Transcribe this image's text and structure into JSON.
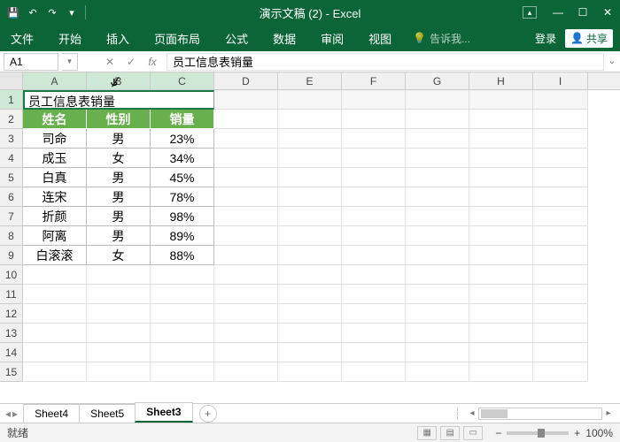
{
  "title": "演示文稿 (2) - Excel",
  "qat": {
    "save": "💾",
    "undo": "↶",
    "redo": "↷"
  },
  "ribbon": {
    "tabs": [
      "文件",
      "开始",
      "插入",
      "页面布局",
      "公式",
      "数据",
      "审阅",
      "视图"
    ],
    "tellme_icon": "💡",
    "tellme": "告诉我...",
    "login": "登录",
    "share": "共享"
  },
  "namebox": "A1",
  "formula": "员工信息表销量",
  "columns": [
    "A",
    "B",
    "C",
    "D",
    "E",
    "F",
    "G",
    "H",
    "I"
  ],
  "row_labels": [
    "1",
    "2",
    "3",
    "4",
    "5",
    "6",
    "7",
    "8",
    "9",
    "10",
    "11",
    "12",
    "13",
    "14",
    "15"
  ],
  "merged_title": "员工信息表销量",
  "headers": [
    "姓名",
    "性别",
    "销量"
  ],
  "data_rows": [
    {
      "name": "司命",
      "gender": "男",
      "sales": "23%"
    },
    {
      "name": "成玉",
      "gender": "女",
      "sales": "34%"
    },
    {
      "name": "白真",
      "gender": "男",
      "sales": "45%"
    },
    {
      "name": "连宋",
      "gender": "男",
      "sales": "78%"
    },
    {
      "name": "折颜",
      "gender": "男",
      "sales": "98%"
    },
    {
      "name": "阿离",
      "gender": "男",
      "sales": "89%"
    },
    {
      "name": "白滚滚",
      "gender": "女",
      "sales": "88%"
    }
  ],
  "sheets": [
    "Sheet4",
    "Sheet5",
    "Sheet3"
  ],
  "active_sheet": 2,
  "status": "就绪",
  "zoom": "100%"
}
